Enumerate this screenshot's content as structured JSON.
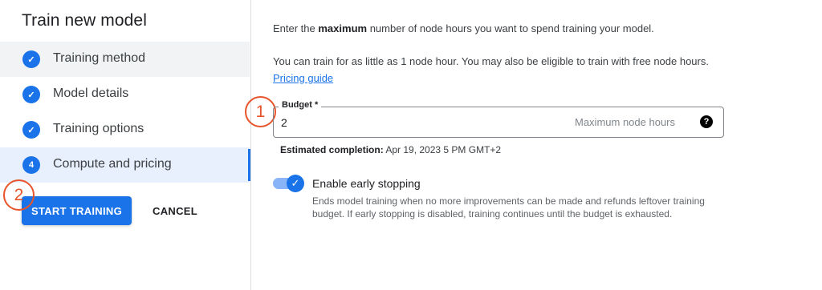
{
  "sidebar": {
    "title": "Train new model",
    "steps": [
      {
        "label": "Training method",
        "marker": "✓"
      },
      {
        "label": "Model details",
        "marker": "✓"
      },
      {
        "label": "Training options",
        "marker": "✓"
      },
      {
        "label": "Compute and pricing",
        "marker": "4"
      }
    ],
    "start_label": "START TRAINING",
    "cancel_label": "CANCEL"
  },
  "annotations": [
    "1",
    "2"
  ],
  "content": {
    "intro_before": "Enter the ",
    "intro_bold": "maximum",
    "intro_after": " number of node hours you want to spend training your model.",
    "free_text": "You can train for as little as 1 node hour. You may also be eligible to train with free node hours. ",
    "pricing_link": "Pricing guide",
    "budget": {
      "label": "Budget *",
      "value": "2",
      "hint": "Maximum node hours",
      "help_icon": "?"
    },
    "estimated": {
      "label": "Estimated completion:",
      "value": "Apr 19, 2023 5 PM GMT+2"
    },
    "early_stopping": {
      "enabled": true,
      "title": "Enable early stopping",
      "description": "Ends model training when no more improvements can be made and refunds leftover training budget. If early stopping is disabled, training continues until the budget is exhausted."
    }
  },
  "colors": {
    "accent": "#1a73e8",
    "annotation": "#e8542a"
  }
}
